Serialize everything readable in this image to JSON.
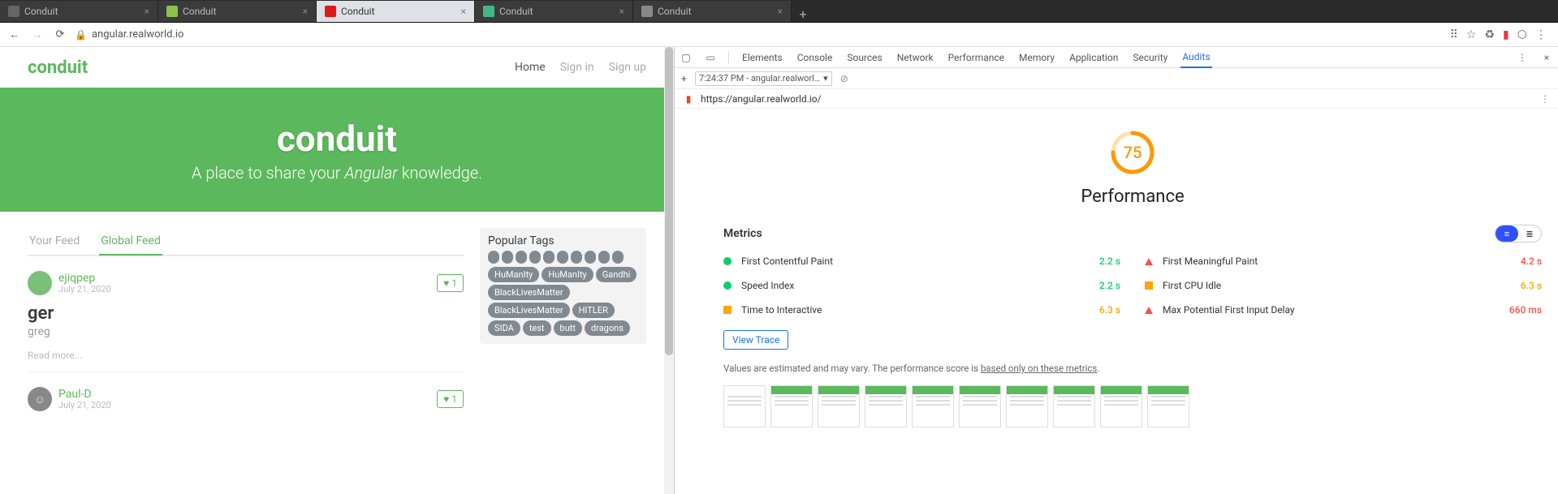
{
  "tabs": [
    {
      "label": "Conduit",
      "favicon": "#666"
    },
    {
      "label": "Conduit",
      "favicon": "#8bc34a"
    },
    {
      "label": "Conduit",
      "favicon": "#dd1b16",
      "active": true
    },
    {
      "label": "Conduit",
      "favicon": "#41b883"
    },
    {
      "label": "Conduit",
      "favicon": "#888"
    }
  ],
  "addressBar": {
    "url": "angular.realworld.io"
  },
  "navbar": {
    "brand": "conduit",
    "links": [
      "Home",
      "Sign in",
      "Sign up"
    ]
  },
  "hero": {
    "title": "conduit",
    "subtitle_a": "A place to share your ",
    "subtitle_em": "Angular",
    "subtitle_b": " knowledge."
  },
  "feedTabs": {
    "yourFeed": "Your Feed",
    "globalFeed": "Global Feed"
  },
  "articles": [
    {
      "author": "ejiqpep",
      "date": "July 21, 2020",
      "likes": "1",
      "title": "ger",
      "desc": "greg",
      "readmore": "Read more...",
      "avatar": "green"
    },
    {
      "author": "Paul-D",
      "date": "July 21, 2020",
      "likes": "1",
      "title": "",
      "desc": "",
      "readmore": "",
      "avatar": "grey"
    }
  ],
  "tags": {
    "title": "Popular Tags",
    "items": [
      "HuManIty",
      "HuManIty",
      "Gandhi",
      "BlackLivesMatter",
      "BlackLivesMatter",
      "HITLER",
      "SIDA",
      "test",
      "butt",
      "dragons"
    ]
  },
  "devtools": {
    "tabs": [
      "Elements",
      "Console",
      "Sources",
      "Network",
      "Performance",
      "Memory",
      "Application",
      "Security",
      "Audits"
    ],
    "activeTab": "Audits",
    "subToolbar": {
      "time": "7:24:37 PM - angular.realworl…"
    },
    "auditUrl": "https://angular.realworld.io/",
    "score": "75",
    "scoreLabel": "Performance",
    "metricsTitle": "Metrics",
    "metrics": [
      {
        "name": "First Contentful Paint",
        "value": "2.2 s",
        "status": "green",
        "shape": "dot"
      },
      {
        "name": "First Meaningful Paint",
        "value": "4.2 s",
        "status": "red",
        "shape": "tri"
      },
      {
        "name": "Speed Index",
        "value": "2.2 s",
        "status": "green",
        "shape": "dot"
      },
      {
        "name": "First CPU Idle",
        "value": "6.3 s",
        "status": "orange",
        "shape": "sq"
      },
      {
        "name": "Time to Interactive",
        "value": "6.3 s",
        "status": "orange",
        "shape": "sq"
      },
      {
        "name": "Max Potential First Input Delay",
        "value": "660 ms",
        "status": "red",
        "shape": "tri"
      }
    ],
    "viewTrace": "View Trace",
    "disclaimer_a": "Values are estimated and may vary. The performance score is ",
    "disclaimer_link": "based only on these metrics",
    "disclaimer_b": "."
  },
  "chart_data": {
    "type": "gauge",
    "title": "Performance",
    "values": [
      75
    ],
    "ylim": [
      0,
      100
    ],
    "metrics": [
      {
        "name": "First Contentful Paint",
        "value": 2.2,
        "unit": "s",
        "rating": "fast"
      },
      {
        "name": "First Meaningful Paint",
        "value": 4.2,
        "unit": "s",
        "rating": "slow"
      },
      {
        "name": "Speed Index",
        "value": 2.2,
        "unit": "s",
        "rating": "fast"
      },
      {
        "name": "First CPU Idle",
        "value": 6.3,
        "unit": "s",
        "rating": "average"
      },
      {
        "name": "Time to Interactive",
        "value": 6.3,
        "unit": "s",
        "rating": "average"
      },
      {
        "name": "Max Potential First Input Delay",
        "value": 660,
        "unit": "ms",
        "rating": "slow"
      }
    ]
  }
}
